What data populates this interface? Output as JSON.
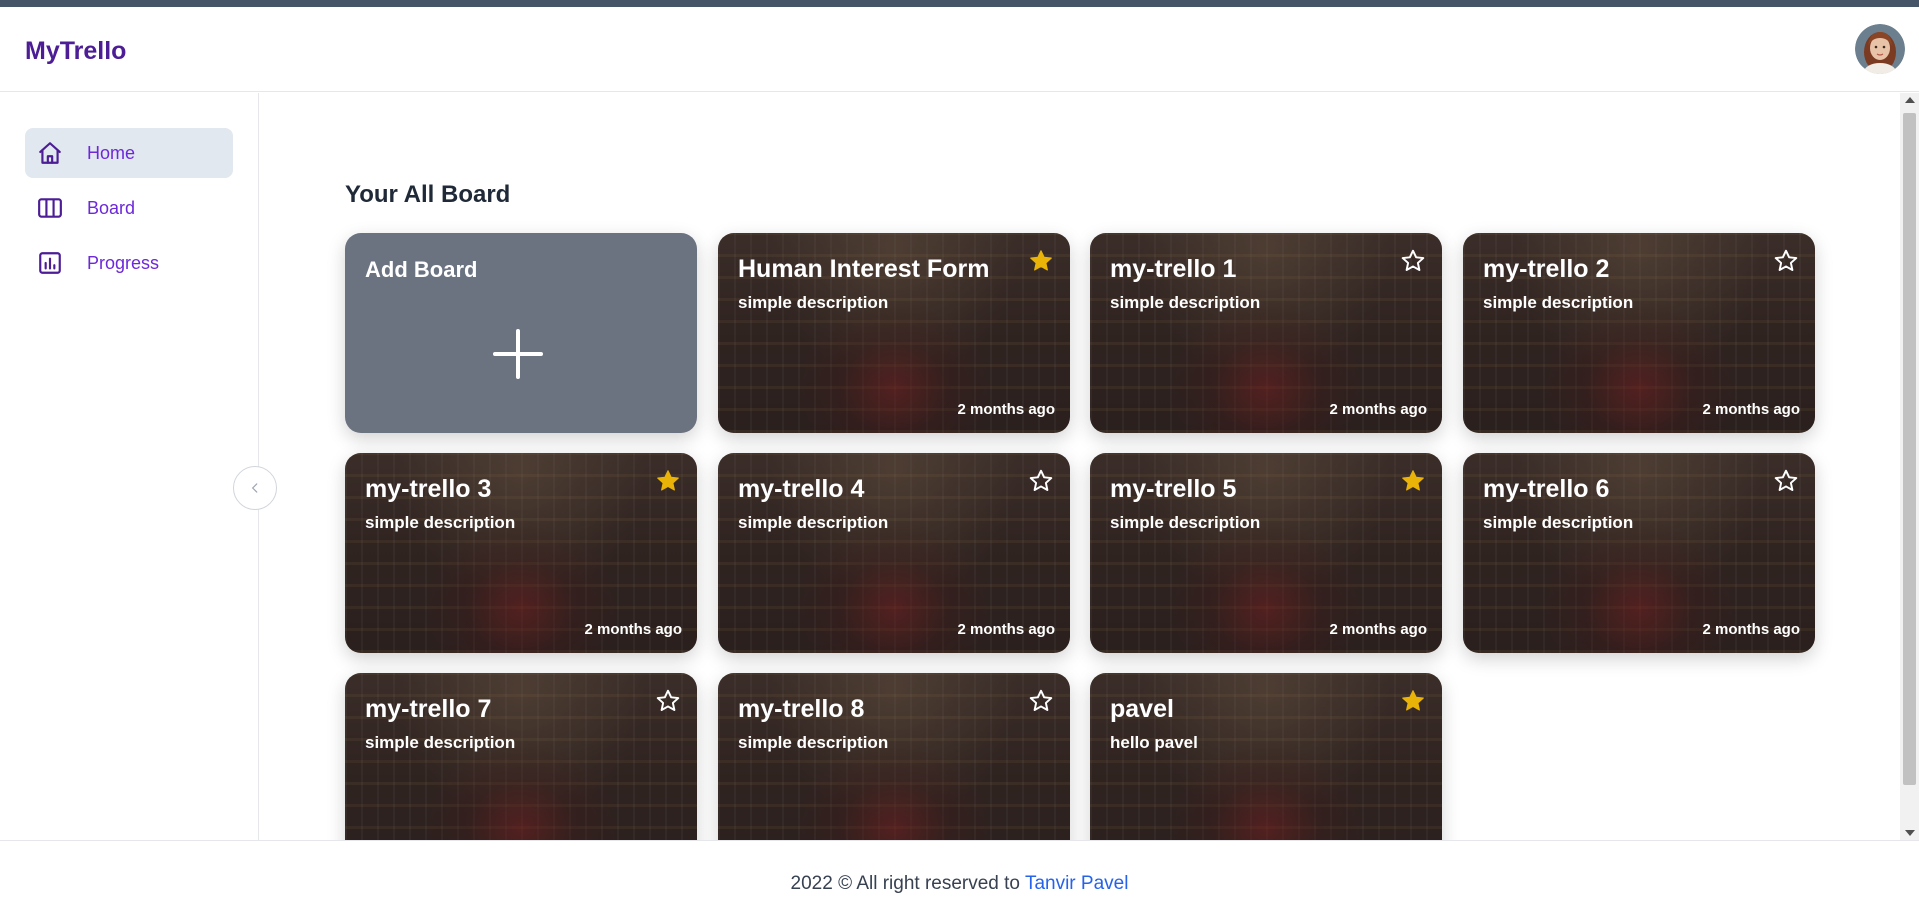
{
  "app": {
    "brand": "MyTrello"
  },
  "colors": {
    "accent": "#6d28d9",
    "brand": "#4c1d95",
    "star_active": "#eab308",
    "card_add_bg": "#6b7280"
  },
  "sidebar": {
    "items": [
      {
        "label": "Home",
        "icon": "home-icon",
        "active": true
      },
      {
        "label": "Board",
        "icon": "columns-icon",
        "active": false
      },
      {
        "label": "Progress",
        "icon": "chart-icon",
        "active": false
      }
    ],
    "collapse_icon": "chevron-left-icon"
  },
  "main": {
    "title": "Your All Board",
    "add_card": {
      "label": "Add Board",
      "icon": "plus-icon"
    },
    "boards": [
      {
        "title": "Human Interest Form",
        "description": "simple description",
        "time": "2 months ago",
        "starred": true
      },
      {
        "title": "my-trello 1",
        "description": "simple description",
        "time": "2 months ago",
        "starred": false
      },
      {
        "title": "my-trello 2",
        "description": "simple description",
        "time": "2 months ago",
        "starred": false
      },
      {
        "title": "my-trello 3",
        "description": "simple description",
        "time": "2 months ago",
        "starred": true
      },
      {
        "title": "my-trello 4",
        "description": "simple description",
        "time": "2 months ago",
        "starred": false
      },
      {
        "title": "my-trello 5",
        "description": "simple description",
        "time": "2 months ago",
        "starred": true
      },
      {
        "title": "my-trello 6",
        "description": "simple description",
        "time": "2 months ago",
        "starred": false
      },
      {
        "title": "my-trello 7",
        "description": "simple description",
        "time": "",
        "starred": false
      },
      {
        "title": "my-trello 8",
        "description": "simple description",
        "time": "",
        "starred": false
      },
      {
        "title": "pavel",
        "description": "hello pavel",
        "time": "",
        "starred": true
      }
    ]
  },
  "footer": {
    "text": "2022 © All right reserved to",
    "author": "Tanvir Pavel"
  }
}
